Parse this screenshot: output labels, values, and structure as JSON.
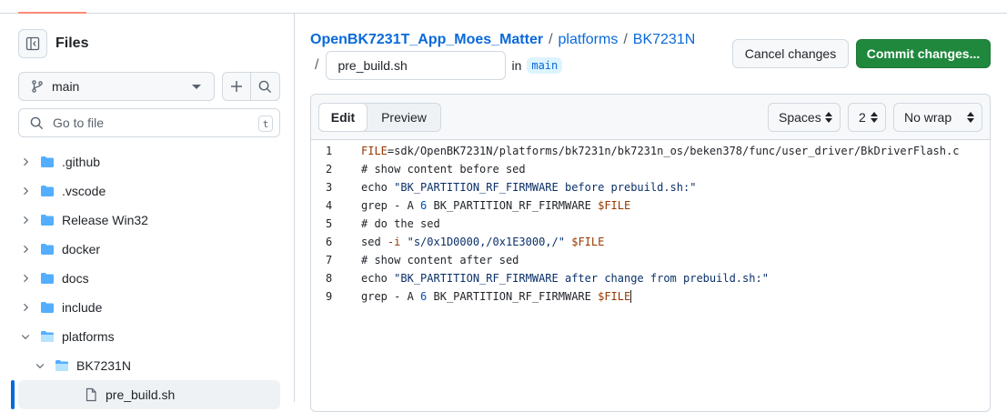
{
  "sidebar": {
    "title": "Files",
    "branch": "main",
    "goto_placeholder": "Go to file",
    "goto_shortcut": "t",
    "tree": [
      {
        "name": ".github",
        "type": "folder",
        "level": 0,
        "expanded": false
      },
      {
        "name": ".vscode",
        "type": "folder",
        "level": 0,
        "expanded": false
      },
      {
        "name": "Release Win32",
        "type": "folder",
        "level": 0,
        "expanded": false
      },
      {
        "name": "docker",
        "type": "folder",
        "level": 0,
        "expanded": false
      },
      {
        "name": "docs",
        "type": "folder",
        "level": 0,
        "expanded": false
      },
      {
        "name": "include",
        "type": "folder",
        "level": 0,
        "expanded": false
      },
      {
        "name": "platforms",
        "type": "folder",
        "level": 0,
        "expanded": true
      },
      {
        "name": "BK7231N",
        "type": "folder",
        "level": 1,
        "expanded": true
      },
      {
        "name": "pre_build.sh",
        "type": "file",
        "level": 2,
        "selected": true
      }
    ]
  },
  "header": {
    "repo": "OpenBK7231T_App_Moes_Matter",
    "sep1": "/",
    "path1": "platforms",
    "sep2": "/",
    "path2": "BK7231N",
    "slash": "/",
    "filename": "pre_build.sh",
    "in_label": "in",
    "branch_tag": "main",
    "cancel_label": "Cancel changes",
    "commit_label": "Commit changes..."
  },
  "editor": {
    "tab_edit": "Edit",
    "tab_preview": "Preview",
    "indent_mode": "Spaces",
    "indent_size": "2",
    "wrap_mode": "No wrap",
    "lines": [
      {
        "n": "1",
        "parts": [
          {
            "t": "FILE",
            "c": "k"
          },
          {
            "t": "=sdk/OpenBK7231N/platforms/bk7231n/bk7231n_os/beken378/func/user_driver/BkDriverFlash.c",
            "c": ""
          }
        ]
      },
      {
        "n": "2",
        "parts": [
          {
            "t": "# show content before sed",
            "c": ""
          }
        ]
      },
      {
        "n": "3",
        "parts": [
          {
            "t": "echo ",
            "c": ""
          },
          {
            "t": "\"BK_PARTITION_RF_FIRMWARE before prebuild.sh:\"",
            "c": "str"
          }
        ]
      },
      {
        "n": "4",
        "parts": [
          {
            "t": "grep - A ",
            "c": ""
          },
          {
            "t": "6",
            "c": "num"
          },
          {
            "t": " BK_PARTITION_RF_FIRMWARE ",
            "c": ""
          },
          {
            "t": "$FILE",
            "c": "var"
          }
        ]
      },
      {
        "n": "5",
        "parts": [
          {
            "t": "# do the sed",
            "c": ""
          }
        ]
      },
      {
        "n": "6",
        "parts": [
          {
            "t": "sed ",
            "c": ""
          },
          {
            "t": "-i",
            "c": "k"
          },
          {
            "t": " ",
            "c": ""
          },
          {
            "t": "\"s/0x1D0000,/0x1E3000,/\"",
            "c": "str"
          },
          {
            "t": " ",
            "c": ""
          },
          {
            "t": "$FILE",
            "c": "var"
          }
        ]
      },
      {
        "n": "7",
        "parts": [
          {
            "t": "# show content after sed",
            "c": ""
          }
        ]
      },
      {
        "n": "8",
        "parts": [
          {
            "t": "echo ",
            "c": ""
          },
          {
            "t": "\"BK_PARTITION_RF_FIRMWARE after change from prebuild.sh:\"",
            "c": "str"
          }
        ]
      },
      {
        "n": "9",
        "parts": [
          {
            "t": "grep - A ",
            "c": ""
          },
          {
            "t": "6",
            "c": "num"
          },
          {
            "t": " BK_PARTITION_RF_FIRMWARE ",
            "c": ""
          },
          {
            "t": "$FILE",
            "c": "var"
          }
        ]
      }
    ]
  }
}
